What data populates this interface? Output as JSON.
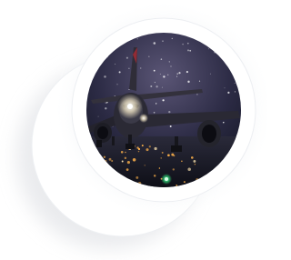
{
  "badge": {
    "subject": "airplane-at-night-photo",
    "colors": {
      "background": "#ffffff",
      "sky_top": "#1a1c33",
      "sky_bottom": "#4a4460",
      "ground": "#0d1019",
      "runway_light_warm": "#ffb24a",
      "runway_light_green": "#35ff8a",
      "fuselage": "#2b2a35",
      "landing_light": "#fff6dc"
    }
  }
}
